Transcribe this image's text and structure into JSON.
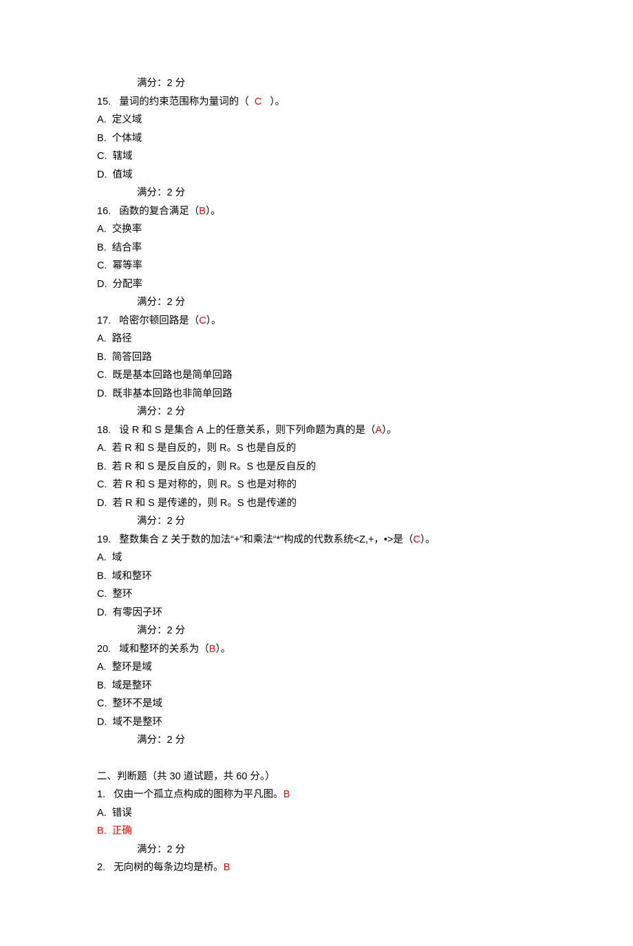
{
  "score_line": "满分：2   分",
  "questions": [
    {
      "num": "15.",
      "prefix": "量词的约束范围称为量词的（  ",
      "answer": "C",
      "suffix": "   ）。",
      "options": [
        "A.  定义域",
        "B.  个体域",
        "C.  辖域",
        "D.  值域"
      ]
    },
    {
      "num": "16.",
      "prefix": "函数的复合满足（",
      "answer": "B",
      "suffix": "）。",
      "options": [
        "A.  交换率",
        "B.  结合率",
        "C.  幂等率",
        "D.  分配率"
      ]
    },
    {
      "num": "17.",
      "prefix": "哈密尔顿回路是（",
      "answer": "C",
      "suffix": "）。",
      "options": [
        "A.  路径",
        "B.  简答回路",
        "C.  既是基本回路也是简单回路",
        "D.  既非基本回路也非简单回路"
      ]
    },
    {
      "num": "18.",
      "prefix": "设 R 和 S 是集合 A 上的任意关系，则下列命题为真的是（",
      "answer": "A",
      "suffix": "）。",
      "options": [
        "A.  若 R 和 S 是自反的，则 R。S 也是自反的",
        "B.  若 R 和 S 是反自反的，则 R。S 也是反自反的",
        "C.  若 R 和 S 是对称的，则 R。S 也是对称的",
        "D.  若 R 和 S 是传递的，则 R。S 也是传递的"
      ]
    },
    {
      "num": "19.",
      "prefix": "整数集合 Z 关于数的加法“+”和乘法“*”构成的代数系统<Z,+，•>是（",
      "answer": "C",
      "suffix": "）。",
      "options": [
        "A.  域",
        "B.  域和整环",
        "C.  整环",
        "D.  有零因子环"
      ]
    },
    {
      "num": "20.",
      "prefix": "域和整环的关系为（",
      "answer": "B",
      "suffix": "）。",
      "options": [
        "A.  整环是域",
        "B.  域是整环",
        "C.  整环不是域",
        "D.  域不是整环"
      ]
    }
  ],
  "section2_title": "二、判断题（共 30 道试题，共 60 分。）",
  "tf_questions": [
    {
      "num": "1.",
      "text": "仅由一个孤立点构成的图称为平凡图。",
      "answer": "B",
      "options": [
        {
          "text": "A.  错误",
          "red": false
        },
        {
          "text": "B.  正确",
          "red": true
        }
      ],
      "show_score": true
    },
    {
      "num": "2.",
      "text": "无向树的每条边均是桥。",
      "answer": "B",
      "options": [],
      "show_score": false
    }
  ]
}
